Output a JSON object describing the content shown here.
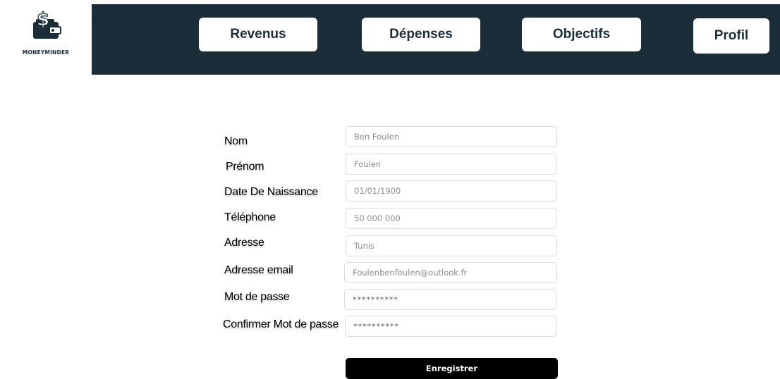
{
  "brand": {
    "name": "MONEYMINDER",
    "logo_icon": "wallet-dollar-icon"
  },
  "nav": {
    "revenus": "Revenus",
    "depenses": "Dépenses",
    "objectifs": "Objectifs",
    "profil": "Profil"
  },
  "form": {
    "nom": {
      "label": "Nom",
      "placeholder": "Ben Foulen"
    },
    "prenom": {
      "label": "Prénom",
      "placeholder": "Foulen"
    },
    "date_naissance": {
      "label": "Date De Naissance",
      "placeholder": "01/01/1900"
    },
    "telephone": {
      "label": "Téléphone",
      "placeholder": "50 000 000"
    },
    "adresse": {
      "label": "Adresse",
      "placeholder": "Tunis"
    },
    "email": {
      "label": "Adresse email",
      "placeholder": "Foulenbenfoulen@outlook.fr"
    },
    "mot_de_passe": {
      "label": "Mot de passe",
      "value": "**********"
    },
    "confirmer": {
      "label": "Confirmer Mot de  passe",
      "value": "**********"
    },
    "submit_label": "Enregistrer"
  },
  "colors": {
    "navbar": "#1c2d3a",
    "button": "#000000"
  }
}
